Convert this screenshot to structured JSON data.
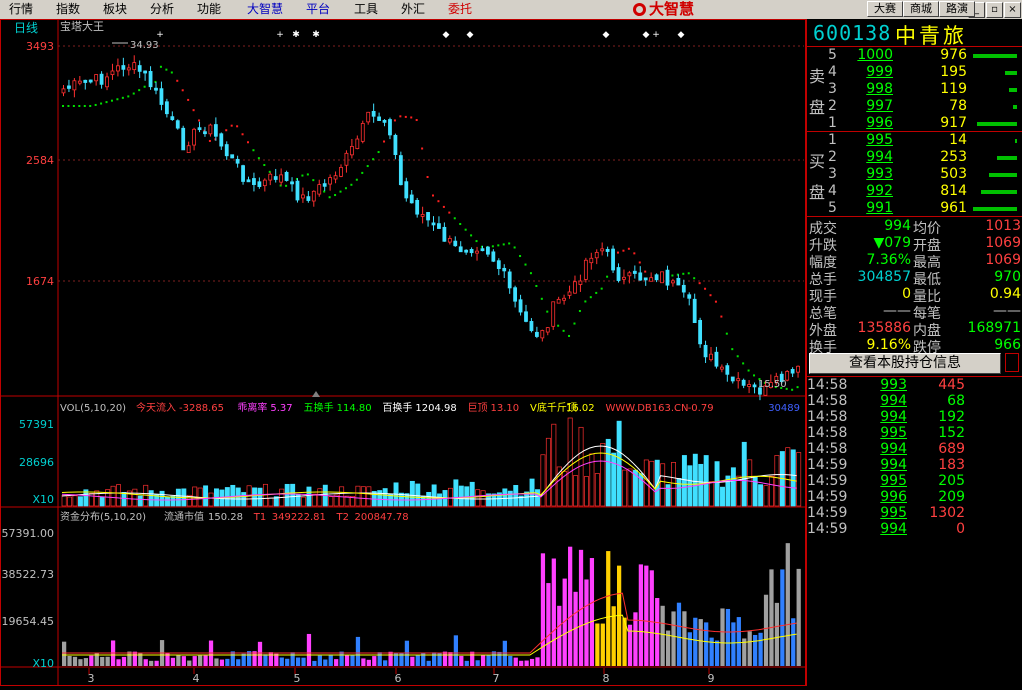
{
  "menu": {
    "items": [
      {
        "label": "行情",
        "color": "black"
      },
      {
        "label": "指数",
        "color": "black"
      },
      {
        "label": "板块",
        "color": "black"
      },
      {
        "label": "分析",
        "color": "black"
      },
      {
        "label": "功能",
        "color": "black"
      },
      {
        "label": "大智慧",
        "color": "blue"
      },
      {
        "label": "平台",
        "color": "blue"
      },
      {
        "label": "工具",
        "color": "black"
      },
      {
        "label": "外汇",
        "color": "black"
      },
      {
        "label": "委托",
        "color": "red"
      }
    ],
    "logo_text": "大智慧",
    "right_buttons": [
      "大赛",
      "商城",
      "路演"
    ],
    "window_buttons": [
      "_",
      "▫",
      "×"
    ]
  },
  "chart": {
    "period_label": "日线",
    "indicator_name": "宝塔大王",
    "high_mark": "34.93",
    "low_mark": "15.50",
    "price_axis": [
      "3493",
      "2584",
      "1674"
    ],
    "vol_header": {
      "prefix": "VOL(5,10,20)",
      "items": [
        {
          "label": "今天流入",
          "value": "-3288.65",
          "color": "#ff4040"
        },
        {
          "label": "乖离率",
          "value": "5.37",
          "color": "#ff40ff"
        },
        {
          "label": "五换手",
          "value": "114.80",
          "color": "#00ff00"
        },
        {
          "label": "百换手",
          "value": "1204.98",
          "color": "#ffffff"
        },
        {
          "label": "巨顶",
          "value": "13.10",
          "color": "#ff4040"
        },
        {
          "label": "V底千斤顶",
          "value": "16.02",
          "color": "#ffff00"
        },
        {
          "label": "WWW.DB163.CN",
          "value": "-0.79",
          "color": "#ff4040"
        }
      ],
      "right_value": "30489"
    },
    "vol_axis": [
      "57391",
      "28696"
    ],
    "vol_unit": "X10",
    "fund_header": {
      "prefix": "资金分布(5,10,20)",
      "items": [
        {
          "label": "流通市值",
          "value": "150.28",
          "color": "#c0c0c0"
        },
        {
          "label": "T1",
          "value": "349222.81",
          "color": "#ff4040"
        },
        {
          "label": "T2",
          "value": "200847.78",
          "color": "#ff4040"
        }
      ]
    },
    "fund_axis": [
      "57391.00",
      "38522.73",
      "19654.45"
    ],
    "fund_unit": "X10",
    "x_labels": [
      "3",
      "4",
      "5",
      "6",
      "7",
      "8",
      "9"
    ]
  },
  "quote": {
    "code": "600138",
    "name": "中青旅",
    "sell_label": "卖盘",
    "buy_label": "买盘",
    "sell": [
      {
        "level": "5",
        "price": "1000",
        "qty": "976",
        "bar": 0.55
      },
      {
        "level": "4",
        "price": "999",
        "qty": "195",
        "bar": 0.15
      },
      {
        "level": "3",
        "price": "998",
        "qty": "119",
        "bar": 0.1
      },
      {
        "level": "2",
        "price": "997",
        "qty": "78",
        "bar": 0.05
      },
      {
        "level": "1",
        "price": "996",
        "qty": "917",
        "bar": 0.5
      }
    ],
    "buy": [
      {
        "level": "1",
        "price": "995",
        "qty": "14",
        "bar": 0.02
      },
      {
        "level": "2",
        "price": "994",
        "qty": "253",
        "bar": 0.25
      },
      {
        "level": "3",
        "price": "993",
        "qty": "503",
        "bar": 0.35
      },
      {
        "level": "4",
        "price": "992",
        "qty": "814",
        "bar": 0.45
      },
      {
        "level": "5",
        "price": "991",
        "qty": "961",
        "bar": 0.55
      }
    ],
    "stats": [
      {
        "l1": "成交",
        "v1": "994",
        "c1": "#00ff00",
        "l2": "均价",
        "v2": "1013",
        "c2": "#ff4040"
      },
      {
        "l1": "升跌",
        "v1": "▼079",
        "c1": "#00ff00",
        "l2": "开盘",
        "v2": "1069",
        "c2": "#ff4040"
      },
      {
        "l1": "幅度",
        "v1": "7.36%",
        "c1": "#00ff00",
        "l2": "最高",
        "v2": "1069",
        "c2": "#ff4040"
      },
      {
        "l1": "总手",
        "v1": "304857",
        "c1": "#00d0d0",
        "l2": "最低",
        "v2": "970",
        "c2": "#00ff00"
      },
      {
        "l1": "现手",
        "v1": "0",
        "c1": "#ffff00",
        "l2": "量比",
        "v2": "0.94",
        "c2": "#ffff00"
      },
      {
        "l1": "总笔",
        "v1": "——",
        "c1": "#c0c0c0",
        "l2": "每笔",
        "v2": "——",
        "c2": "#c0c0c0"
      },
      {
        "l1": "外盘",
        "v1": "135886",
        "c1": "#ff4040",
        "l2": "内盘",
        "v2": "168971",
        "c2": "#00ff00"
      },
      {
        "l1": "换手",
        "v1": "9.16%",
        "c1": "#ffff00",
        "l2": "跌停",
        "v2": "966",
        "c2": "#00ff00"
      }
    ],
    "detail_button": "查看本股持仓信息",
    "ticks": [
      {
        "time": "14:58",
        "price": "993",
        "vol": "445",
        "dir": "up"
      },
      {
        "time": "14:58",
        "price": "994",
        "vol": "68",
        "dir": "down"
      },
      {
        "time": "14:58",
        "price": "994",
        "vol": "192",
        "dir": "down"
      },
      {
        "time": "14:58",
        "price": "995",
        "vol": "152",
        "dir": "down"
      },
      {
        "time": "14:58",
        "price": "994",
        "vol": "689",
        "dir": "up"
      },
      {
        "time": "14:59",
        "price": "994",
        "vol": "183",
        "dir": "up"
      },
      {
        "time": "14:59",
        "price": "995",
        "vol": "205",
        "dir": "down"
      },
      {
        "time": "14:59",
        "price": "996",
        "vol": "209",
        "dir": "down"
      },
      {
        "time": "14:59",
        "price": "995",
        "vol": "1302",
        "dir": "up"
      },
      {
        "time": "14:59",
        "price": "994",
        "vol": "0",
        "dir": "up"
      }
    ]
  }
}
